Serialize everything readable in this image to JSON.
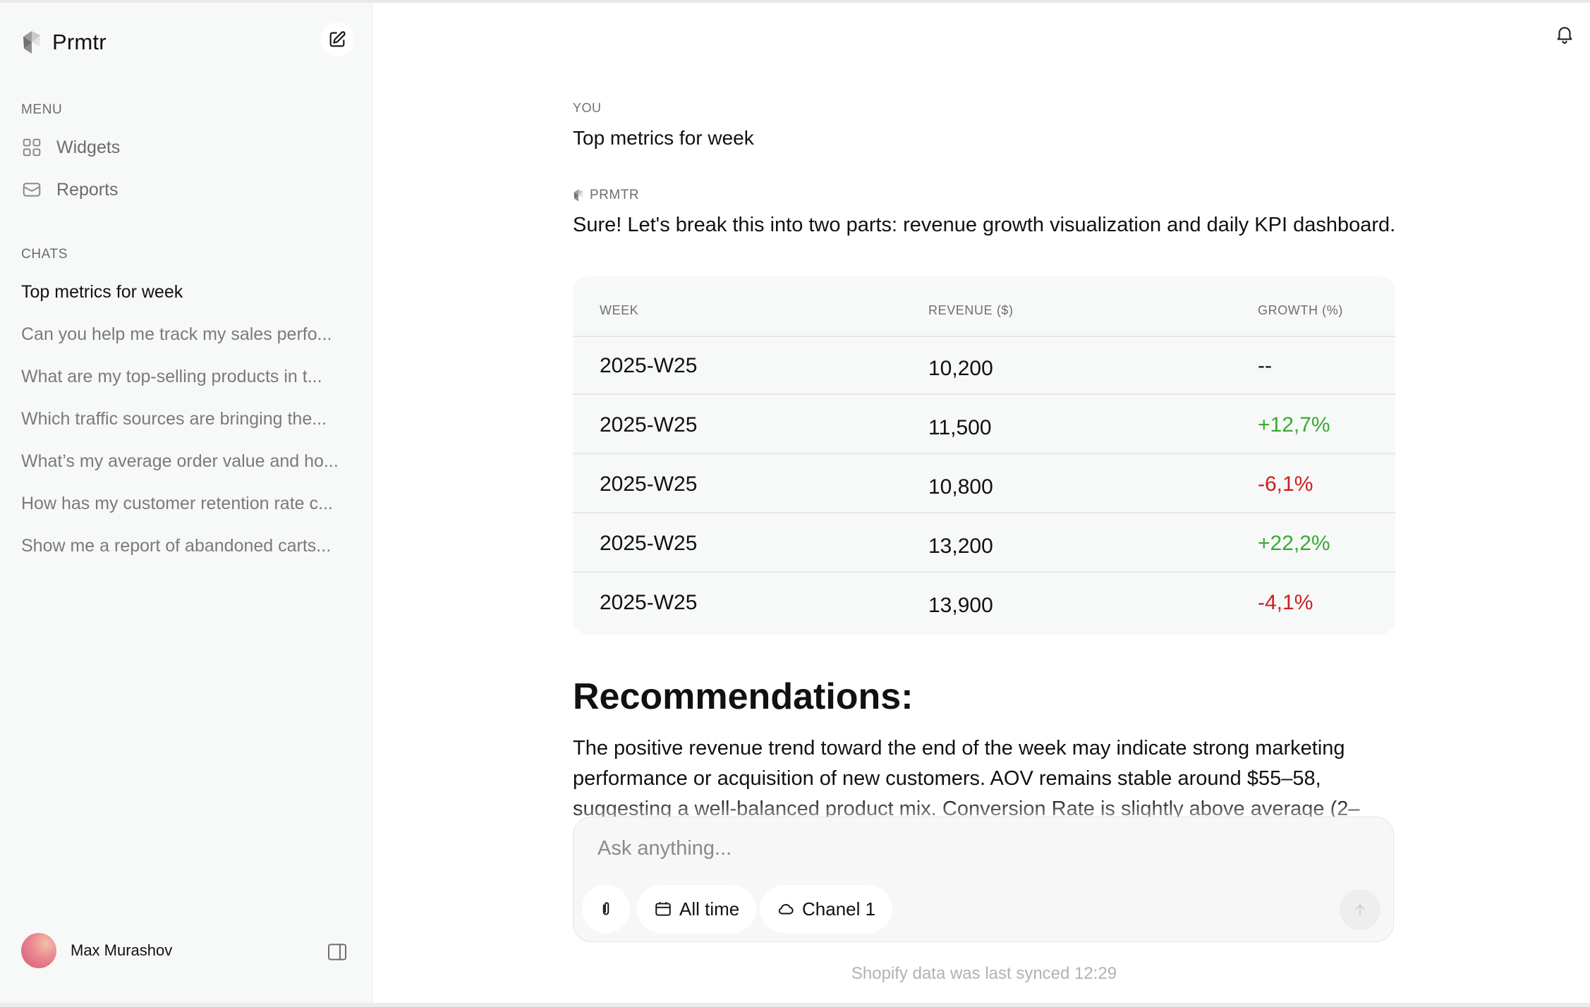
{
  "app": {
    "name": "Prmtr"
  },
  "sidebar": {
    "menu_label": "MENU",
    "menu": [
      {
        "label": "Widgets",
        "icon": "grid-icon"
      },
      {
        "label": "Reports",
        "icon": "mail-icon"
      }
    ],
    "chats_label": "CHATS",
    "chats": [
      {
        "label": "Top metrics for week",
        "active": true
      },
      {
        "label": "Can you help me track my sales perfo...",
        "active": false
      },
      {
        "label": "What are my top-selling products in t...",
        "active": false
      },
      {
        "label": "Which traffic sources are bringing the...",
        "active": false
      },
      {
        "label": "What’s my average order value and ho...",
        "active": false
      },
      {
        "label": "How has my customer retention rate c...",
        "active": false
      },
      {
        "label": "Show me a report of abandoned carts...",
        "active": false
      }
    ],
    "user": {
      "name": "Max Murashov"
    }
  },
  "conversation": {
    "user_label": "YOU",
    "user_message": "Top metrics for week",
    "bot_label": "PRMTR",
    "bot_message": "Sure! Let's break this into two parts: revenue growth visualization and daily KPI dashboard.",
    "table": {
      "headers": {
        "week": "WEEK",
        "revenue": "REVENUE ($)",
        "growth": "GROWTH (%)"
      },
      "rows": [
        {
          "week": "2025-W25",
          "revenue": "10,200",
          "growth": "--",
          "trend": "none"
        },
        {
          "week": "2025-W25",
          "revenue": "11,500",
          "growth": "+12,7%",
          "trend": "up"
        },
        {
          "week": "2025-W25",
          "revenue": "10,800",
          "growth": "-6,1%",
          "trend": "down"
        },
        {
          "week": "2025-W25",
          "revenue": "13,200",
          "growth": "+22,2%",
          "trend": "up"
        },
        {
          "week": "2025-W25",
          "revenue": "13,900",
          "growth": "-4,1%",
          "trend": "down"
        }
      ]
    },
    "recommendations_title": "Recommendations:",
    "recommendations_text": "The positive revenue trend toward the end of the week may indicate strong marketing performance or acquisition of new customers. AOV remains stable around $55–58, suggesting a well-balanced product mix. Conversion Rate is slightly above average (2–"
  },
  "composer": {
    "placeholder": "Ask anything...",
    "time_filter": "All time",
    "channel_filter": "Chanel 1"
  },
  "sync_status": "Shopify data was last synced 12:29",
  "colors": {
    "up": "#3aaa35",
    "down": "#c8201f",
    "neutral": "#111111"
  }
}
